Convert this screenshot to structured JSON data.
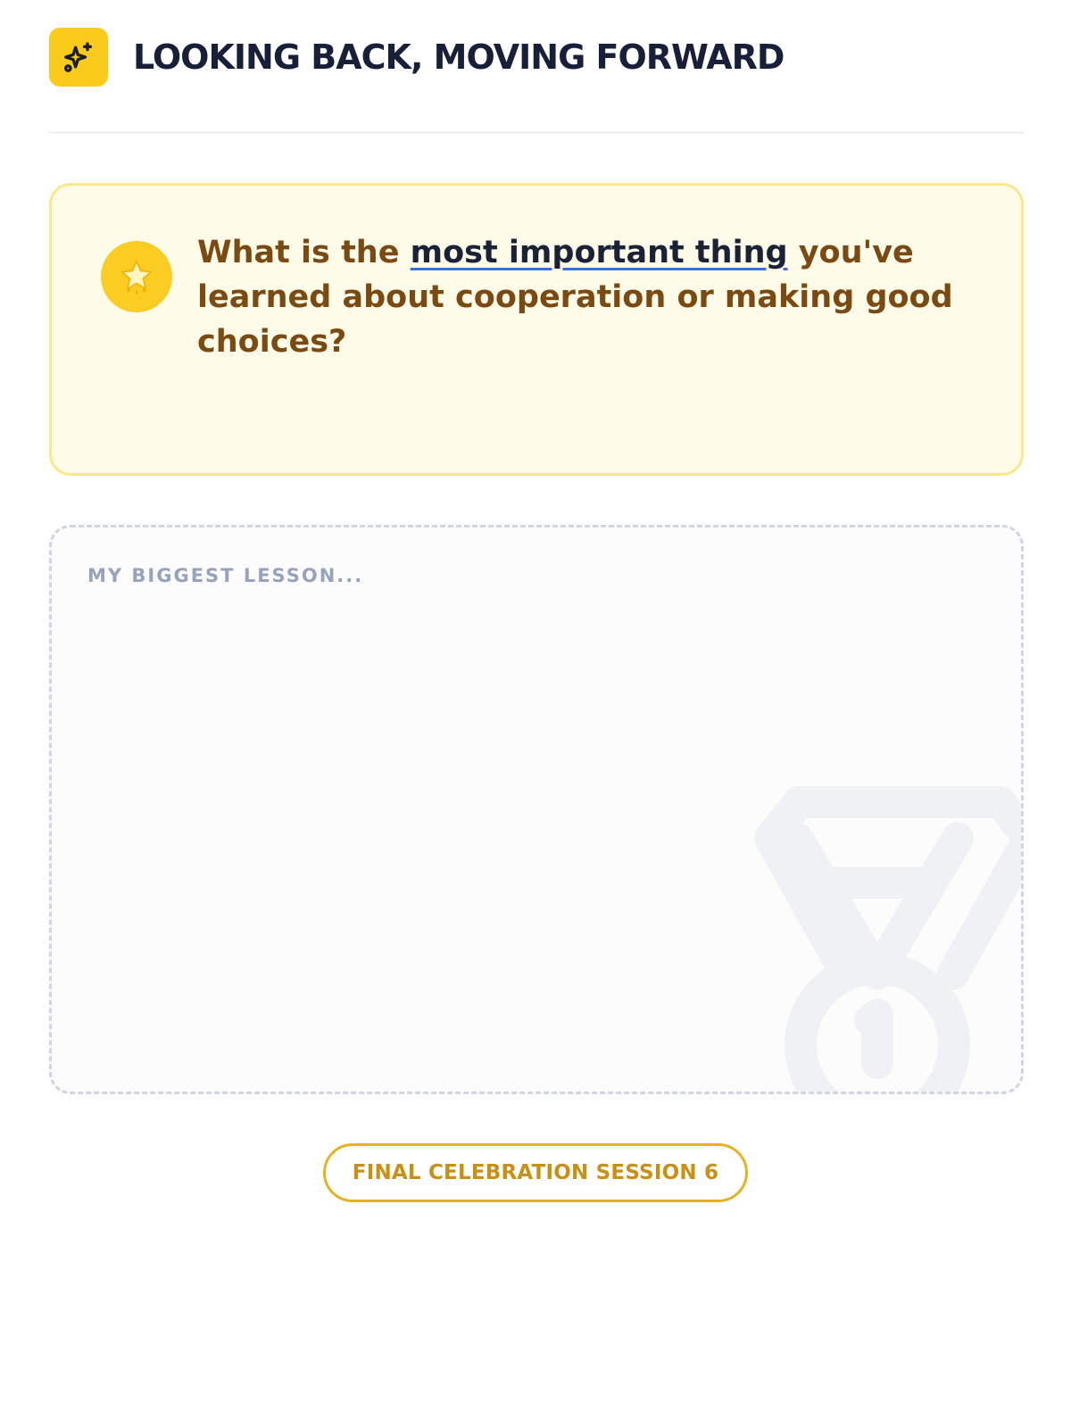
{
  "header": {
    "title": "LOOKING BACK, MOVING FORWARD",
    "icon": "sparkles-icon"
  },
  "prompt": {
    "icon": "star-badge-icon",
    "text_before": "What is the ",
    "text_highlight": "most important thing",
    "text_after": " you've learned about cooperation or making good choices?"
  },
  "answer": {
    "placeholder": "MY BIGGEST LESSON...",
    "value": "",
    "watermark_icon": "medal-icon"
  },
  "session_button": {
    "label": "FINAL CELEBRATION SESSION 6"
  },
  "colors": {
    "accent_yellow": "#fbcb1c",
    "card_bg": "#fefbe8",
    "card_border": "#fbe88a",
    "prompt_text": "#7a4a12",
    "title_text": "#172038",
    "button_text": "#c99014"
  }
}
